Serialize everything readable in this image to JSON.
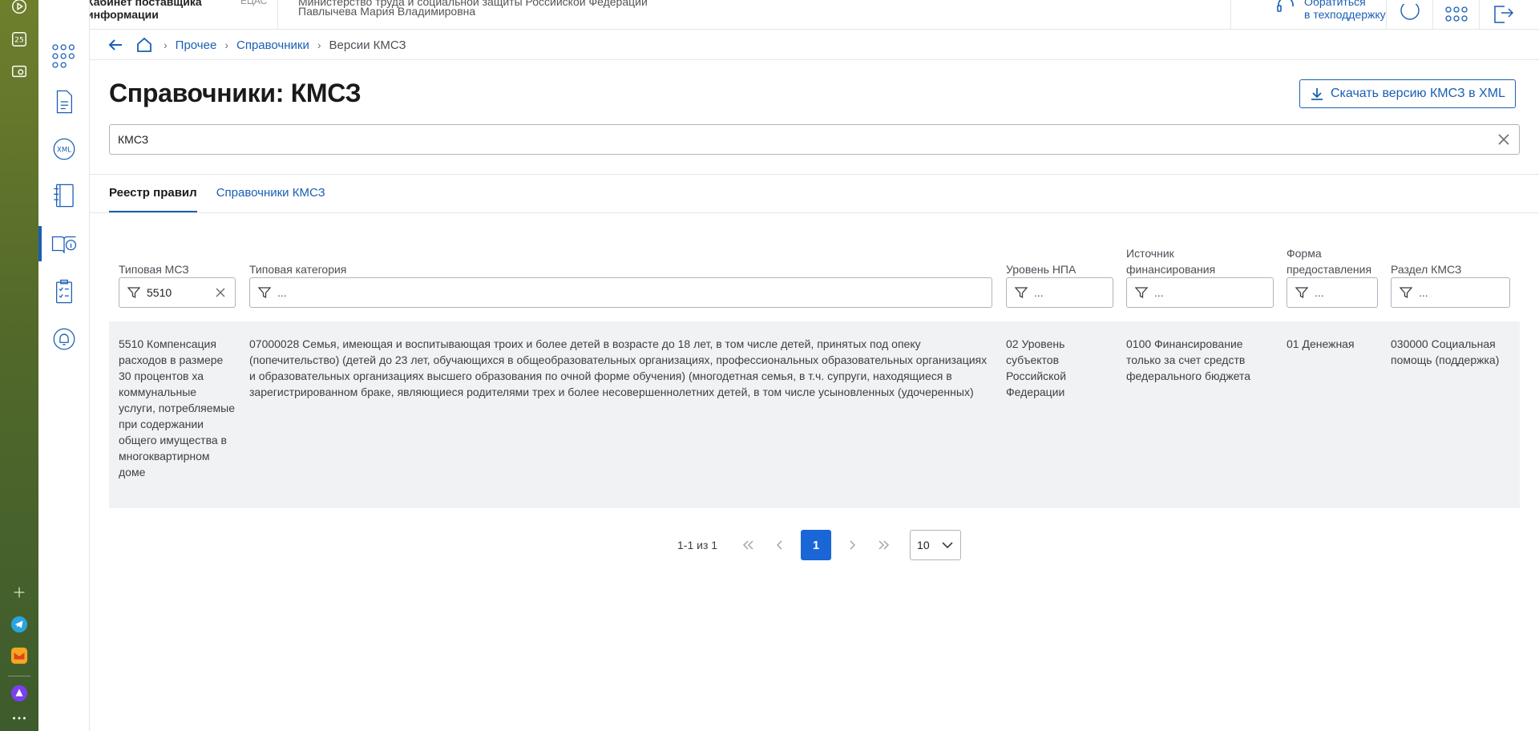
{
  "header": {
    "app_name": "Кабинет поставщика информации",
    "env": "ЕЦАС",
    "user_line1": "Министерство труда и социальной защиты Российской Федерации",
    "user_name": "Павлычева Мария Владимировна",
    "support_line1": "Обратиться",
    "support_line2": "в техподдержку"
  },
  "breadcrumb": {
    "items": [
      "Прочее",
      "Справочники"
    ],
    "current": "Версии КМСЗ"
  },
  "page": {
    "title": "Справочники: КМСЗ",
    "download_label": "Скачать версию КМСЗ в XML"
  },
  "search": {
    "value": "КМСЗ"
  },
  "tabs": [
    {
      "label": "Реестр правил",
      "active": true
    },
    {
      "label": "Справочники КМСЗ",
      "active": false
    }
  ],
  "table": {
    "columns": [
      {
        "label": "Типовая МСЗ",
        "filter_value": "5510"
      },
      {
        "label": "Типовая категория",
        "filter_placeholder": "..."
      },
      {
        "label": "Уровень НПА",
        "filter_placeholder": "..."
      },
      {
        "label": "Источник финансирования",
        "filter_placeholder": "..."
      },
      {
        "label": "Форма предоставления",
        "filter_placeholder": "..."
      },
      {
        "label": "Раздел КМСЗ",
        "filter_placeholder": "..."
      }
    ],
    "rows": [
      {
        "msz": "5510 Компенсация расходов в размере 30 процентов ха коммунальные услуги, потребляемые при содержании общего имущества в многоквартирном доме",
        "category": "07000028 Семья, имеющая и воспитывающая троих и более детей в возрасте до 18 лет, в том числе детей, принятых под опеку (попечительство) (детей до 23 лет, обучающихся в общеобразовательных организациях, профессиональных образовательных организациях и образовательных организациях высшего образования по очной форме обучения) (многодетная семья, в т.ч. супруги, находящиеся в зарегистрированном браке, являющиеся родителями трех и более несовершеннолетних детей, в том числе усыновленных (удочеренных)",
        "level": "02 Уровень субъектов Российской Федерации",
        "funding": "0100 Финансирование только за счет средств федерального бюджета",
        "form": "01 Денежная",
        "section": "030000 Социальная помощь (поддержка)"
      }
    ]
  },
  "pager": {
    "range": "1-1 из 1",
    "current_page": "1",
    "page_size": "10"
  },
  "colors": {
    "accent": "#1a5fb4",
    "active_page": "#1a66d6",
    "row_bg": "#f1f2f4"
  }
}
